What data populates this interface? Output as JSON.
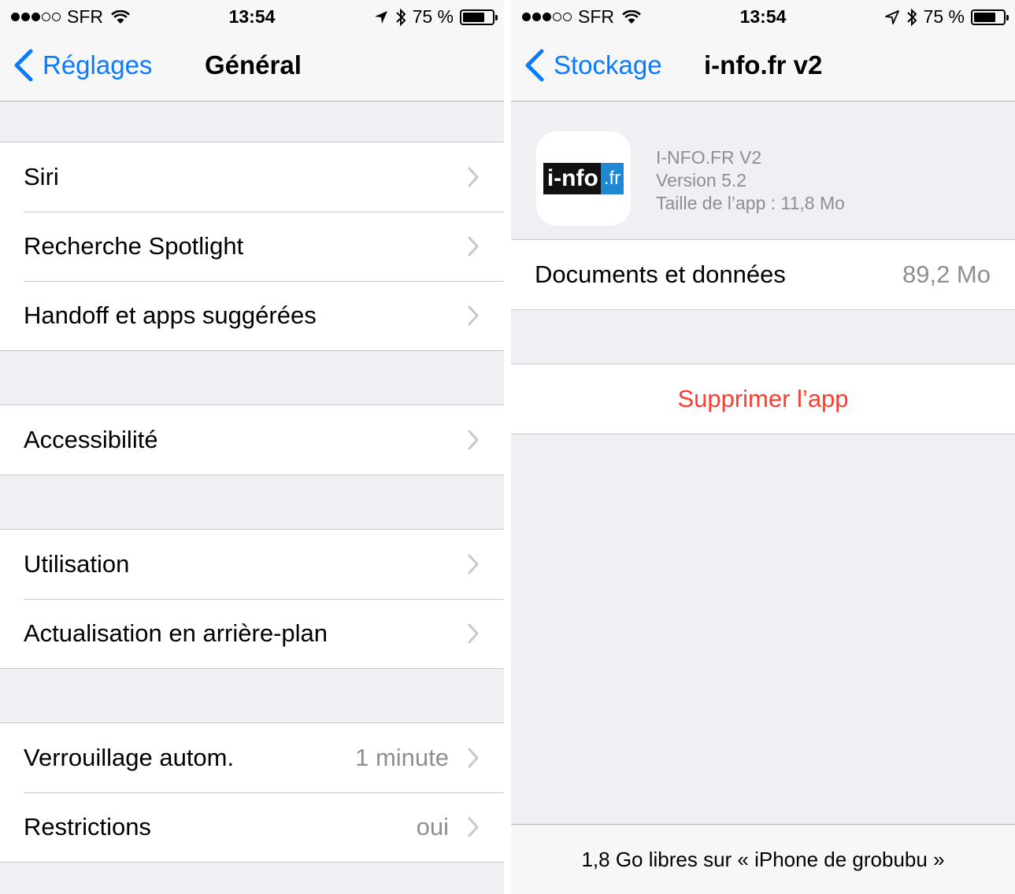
{
  "status_bar": {
    "carrier": "SFR",
    "time": "13:54",
    "battery": "75 %",
    "battery_level": 0.75,
    "signal_bars_filled": 3,
    "signal_bars_total": 5
  },
  "left": {
    "nav": {
      "back_label": "Réglages",
      "title": "Général"
    },
    "groups": [
      [
        {
          "label": "Siri"
        },
        {
          "label": "Recherche Spotlight"
        },
        {
          "label": "Handoff et apps suggérées"
        }
      ],
      [
        {
          "label": "Accessibilité"
        }
      ],
      [
        {
          "label": "Utilisation"
        },
        {
          "label": "Actualisation en arrière-plan"
        }
      ],
      [
        {
          "label": "Verrouillage autom.",
          "value": "1 minute"
        },
        {
          "label": "Restrictions",
          "value": "oui"
        }
      ]
    ]
  },
  "right": {
    "nav": {
      "back_label": "Stockage",
      "title": "i-nfo.fr v2"
    },
    "app": {
      "logo_main": "i-nfo",
      "logo_tld": ".fr",
      "name": "I-NFO.FR V2",
      "version": "Version 5.2",
      "size": "Taille de l’app : 11,8 Mo"
    },
    "documents": {
      "label": "Documents et données",
      "value": "89,2 Mo"
    },
    "delete_label": "Supprimer l’app",
    "footer": "1,8 Go libres sur « iPhone de grobubu »"
  },
  "colors": {
    "accent": "#0a7aff",
    "destructive": "#ff3b30",
    "secondary_text": "#8e8e93",
    "background": "#efeff4"
  },
  "icons": [
    "wifi-icon",
    "location-arrow-icon",
    "bluetooth-icon",
    "battery-icon",
    "chevron-left-icon",
    "chevron-right-icon"
  ]
}
